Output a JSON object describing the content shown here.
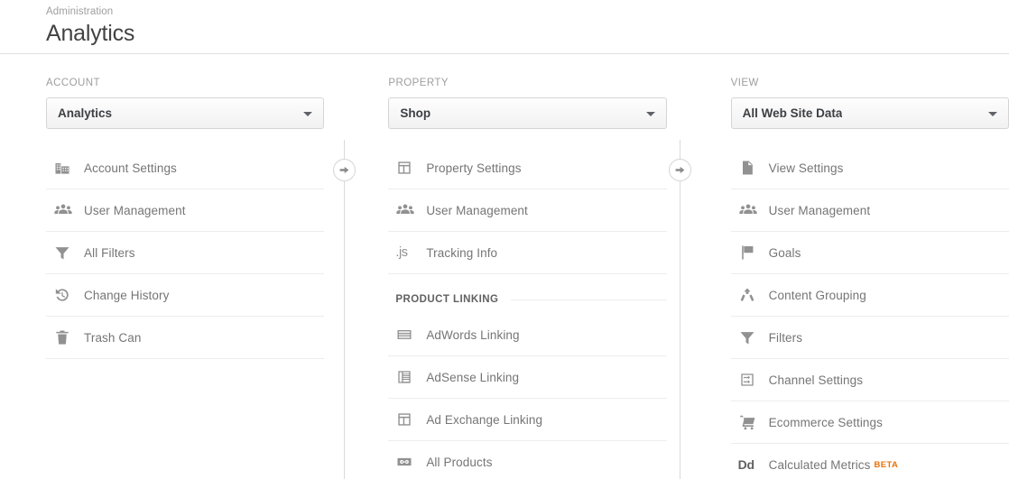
{
  "header": {
    "eyebrow": "Administration",
    "title": "Analytics"
  },
  "columns": {
    "account": {
      "label": "ACCOUNT",
      "selected": "Analytics",
      "items": [
        {
          "label": "Account Settings",
          "icon": "building-icon"
        },
        {
          "label": "User Management",
          "icon": "people-icon"
        },
        {
          "label": "All Filters",
          "icon": "funnel-icon"
        },
        {
          "label": "Change History",
          "icon": "history-icon"
        },
        {
          "label": "Trash Can",
          "icon": "trash-icon"
        }
      ]
    },
    "property": {
      "label": "PROPERTY",
      "selected": "Shop",
      "items": [
        {
          "label": "Property Settings",
          "icon": "window-icon"
        },
        {
          "label": "User Management",
          "icon": "people-icon"
        },
        {
          "label": "Tracking Info",
          "icon": "js-icon"
        }
      ],
      "section": {
        "heading": "PRODUCT LINKING",
        "items": [
          {
            "label": "AdWords Linking",
            "icon": "ad-banner-icon"
          },
          {
            "label": "AdSense Linking",
            "icon": "ad-sidebar-icon"
          },
          {
            "label": "Ad Exchange Linking",
            "icon": "window-icon"
          },
          {
            "label": "All Products",
            "icon": "link-icon"
          }
        ]
      }
    },
    "view": {
      "label": "VIEW",
      "selected": "All Web Site Data",
      "items": [
        {
          "label": "View Settings",
          "icon": "document-icon"
        },
        {
          "label": "User Management",
          "icon": "people-icon"
        },
        {
          "label": "Goals",
          "icon": "flag-icon"
        },
        {
          "label": "Content Grouping",
          "icon": "merge-icon"
        },
        {
          "label": "Filters",
          "icon": "funnel-icon"
        },
        {
          "label": "Channel Settings",
          "icon": "channel-icon"
        },
        {
          "label": "Ecommerce Settings",
          "icon": "cart-icon"
        },
        {
          "label": "Calculated Metrics",
          "icon": "dd-text-icon",
          "badge": "BETA"
        }
      ]
    }
  },
  "connectors": {
    "account_to_property": "arrow-right-icon",
    "property_to_view": "arrow-right-icon"
  },
  "colors": {
    "beta_badge": "#e8710a",
    "label_text": "#9e9e9e",
    "item_text": "#757575",
    "icon": "#919191",
    "divider": "#ededed"
  }
}
